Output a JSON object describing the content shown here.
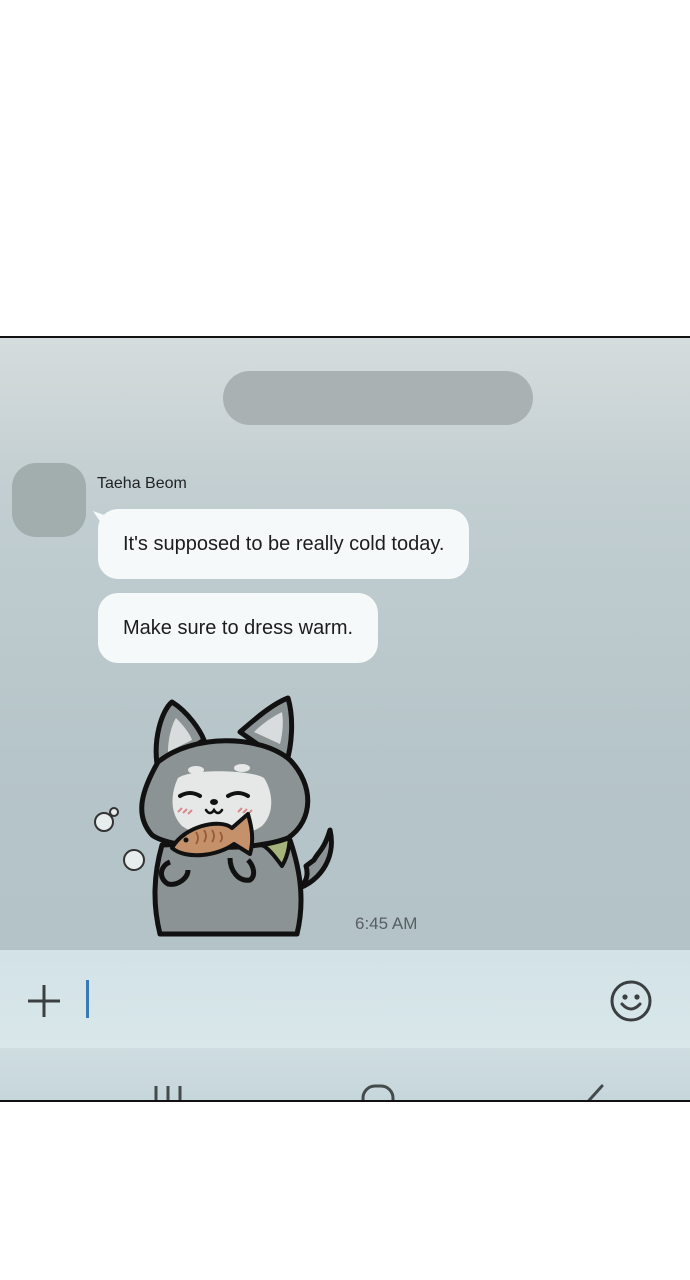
{
  "chat": {
    "sender_name": "Taeha Beom",
    "messages": [
      {
        "text": "It's supposed to be really cold today."
      },
      {
        "text": "Make sure to dress warm."
      }
    ],
    "sticker": {
      "icon": "husky-eating-taiyaki-sticker"
    },
    "timestamp": "6:45 AM"
  },
  "input_bar": {
    "add_icon": "plus-icon",
    "emoji_icon": "smiley-icon",
    "value": ""
  },
  "nav_bar": {
    "icons": [
      "recent-apps-icon",
      "home-icon",
      "back-icon"
    ]
  },
  "colors": {
    "chat_background": "#b6c5c9",
    "bubble": "#f6f9f9",
    "cursor": "#3b79b5",
    "input_bar": "#d6e5e8"
  }
}
